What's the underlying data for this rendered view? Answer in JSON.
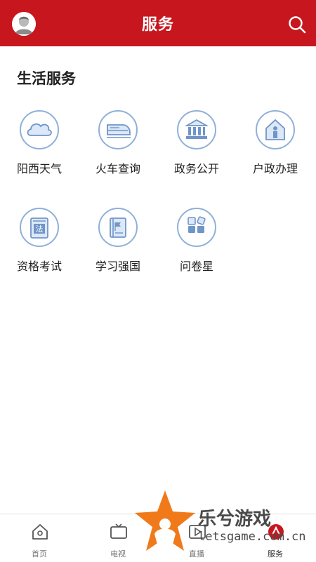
{
  "header": {
    "title": "服务"
  },
  "section": {
    "title": "生活服务"
  },
  "services": [
    {
      "label": "阳西天气",
      "icon": "cloud-icon"
    },
    {
      "label": "火车查询",
      "icon": "train-icon"
    },
    {
      "label": "政务公开",
      "icon": "government-building-icon"
    },
    {
      "label": "户政办理",
      "icon": "household-icon"
    },
    {
      "label": "资格考试",
      "icon": "law-book-icon"
    },
    {
      "label": "学习强国",
      "icon": "study-book-icon"
    },
    {
      "label": "问卷星",
      "icon": "survey-grid-icon"
    }
  ],
  "bottom_nav": [
    {
      "label": "首页",
      "icon": "home-icon"
    },
    {
      "label": "电视",
      "icon": "tv-icon"
    },
    {
      "label": "直播",
      "icon": "live-play-icon"
    },
    {
      "label": "服务",
      "icon": "service-icon",
      "active": true
    }
  ],
  "watermark": {
    "text": "乐兮游戏",
    "site": "letsgame.com.cn"
  },
  "colors": {
    "brand": "#c8161e",
    "icon_stroke": "#8fb0da",
    "icon_fill": "#dce8f7"
  }
}
